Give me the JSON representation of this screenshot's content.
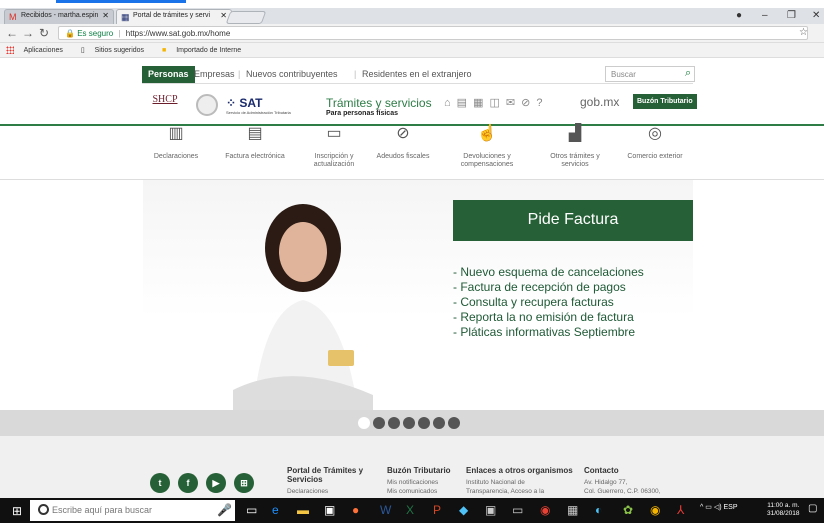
{
  "browser": {
    "tabs": [
      {
        "label": "Recibidos - martha.espin",
        "icon": "gmail-icon"
      },
      {
        "label": "Portal de trámites y servi",
        "icon": "sat-favicon"
      }
    ],
    "window_controls": [
      "●",
      "–",
      "❐",
      "✕"
    ],
    "nav": {
      "back": "←",
      "forward": "→",
      "reload": "↻"
    },
    "secure_label": "Es seguro",
    "url": "https://www.sat.gob.mx/home",
    "bookmarks": [
      "Aplicaciones",
      "Sitios sugeridos",
      "Importado de Interne"
    ]
  },
  "site": {
    "audience_tabs": {
      "active": "Personas",
      "items": [
        "Empresas",
        "Nuevos contribuyentes",
        "Residentes en el extranjero"
      ]
    },
    "search_placeholder": "Buscar",
    "header": {
      "shcp": "SHCP",
      "sat": "SAT",
      "sat_sub": "Servicio de Administración Tributaria",
      "title": "Trámites y servicios",
      "subtitle": "Para personas físicas",
      "gobmx": "gob.mx",
      "buzon": "Buzón Tributario"
    },
    "services": [
      {
        "label": "Declaraciones"
      },
      {
        "label": "Factura electrónica"
      },
      {
        "label": "Inscripción y actualización"
      },
      {
        "label": "Adeudos fiscales"
      },
      {
        "label": "Devoluciones y compensaciones"
      },
      {
        "label": "Otros trámites y servicios"
      },
      {
        "label": "Comercio exterior"
      }
    ],
    "hero": {
      "title": "Pide Factura",
      "items": [
        "- Nuevo esquema de cancelaciones",
        "- Factura de recepción de pagos",
        "- Consulta y recupera facturas",
        "- Reporta la no emisión de factura",
        "- Pláticas informativas Septiembre"
      ],
      "active_slide": 1,
      "slide_count": 7
    },
    "footer": {
      "social": [
        "twitter",
        "facebook",
        "youtube",
        "sitemap"
      ],
      "columns": [
        {
          "heading": "Portal de Trámites y Servicios",
          "items": [
            "Declaraciones"
          ]
        },
        {
          "heading": "Buzón Tributario",
          "items": [
            "Mis notificaciones",
            "Mis comunicados"
          ]
        },
        {
          "heading": "Enlaces a otros organismos",
          "items": [
            "Instituto Nacional de",
            "Transparencia, Acceso a la"
          ]
        },
        {
          "heading": "Contacto",
          "items": [
            "Av. Hidalgo 77,",
            "Col. Guerrero, C.P. 06300,"
          ]
        }
      ]
    }
  },
  "taskbar": {
    "search_placeholder": "Escribe aquí para buscar",
    "lang": "ESP",
    "time": "11:00 a. m.",
    "date": "31/08/2018"
  }
}
